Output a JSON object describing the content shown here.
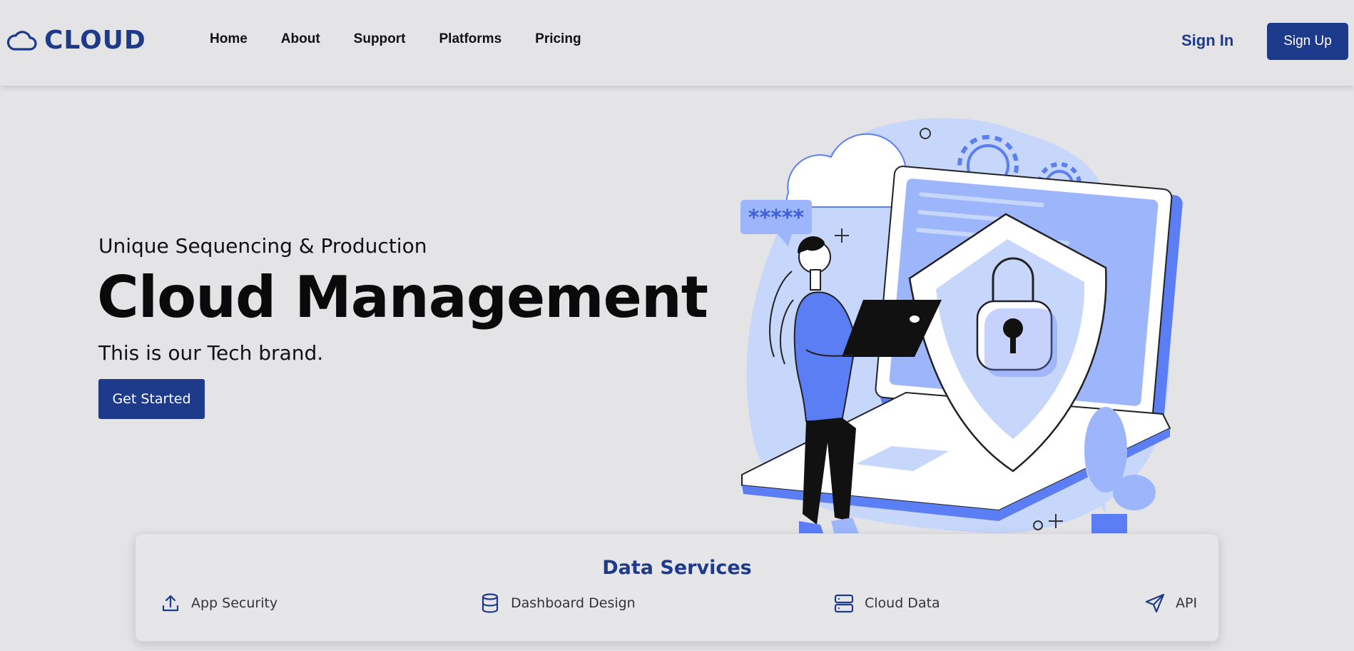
{
  "brand": {
    "name": "CLOUD",
    "icon": "cloud-icon",
    "color": "#1e3a8a"
  },
  "nav": {
    "links": [
      "Home",
      "About",
      "Support",
      "Platforms",
      "Pricing"
    ],
    "sign_in": "Sign In",
    "sign_up": "Sign Up"
  },
  "hero": {
    "subtitle": "Unique Sequencing & Production",
    "title": "Cloud Management",
    "tagline": "This is our Tech brand.",
    "cta": "Get Started",
    "password_bubble": "*****"
  },
  "services": {
    "title": "Data Services",
    "items": [
      {
        "label": "App Security",
        "icon": "upload-icon"
      },
      {
        "label": "Dashboard Design",
        "icon": "database-icon"
      },
      {
        "label": "Cloud Data",
        "icon": "server-icon"
      },
      {
        "label": "API",
        "icon": "send-icon"
      }
    ]
  },
  "colors": {
    "accent": "#1e3a8a",
    "background": "#e4e4e7",
    "illustration_blue": "#5b7ef5",
    "illustration_light": "#c7d6fb"
  }
}
